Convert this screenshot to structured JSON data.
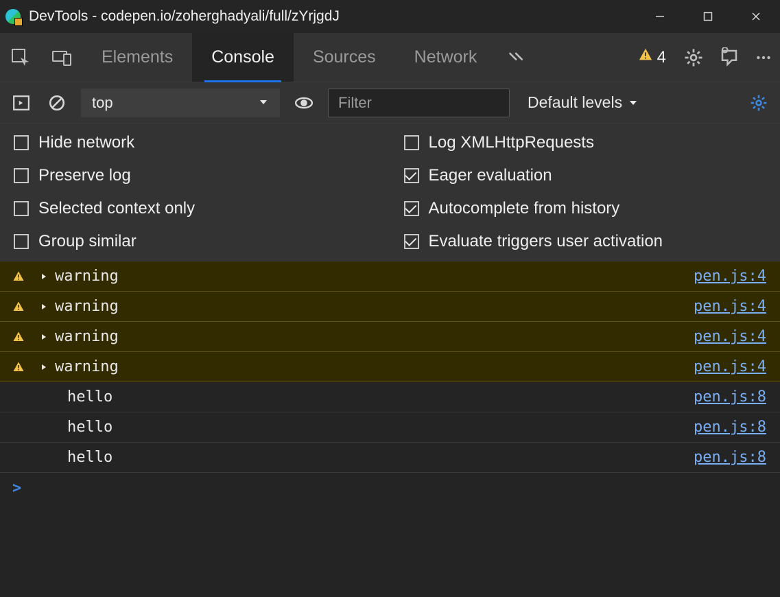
{
  "window": {
    "title": "DevTools - codepen.io/zoherghadyali/full/zYrjgdJ"
  },
  "tabs": {
    "items": [
      "Elements",
      "Console",
      "Sources",
      "Network"
    ],
    "activeIndex": 1,
    "warningCount": "4"
  },
  "toolbar": {
    "context": "top",
    "filterPlaceholder": "Filter",
    "levels": "Default levels"
  },
  "settings": {
    "left": [
      {
        "label": "Hide network",
        "checked": false
      },
      {
        "label": "Preserve log",
        "checked": false
      },
      {
        "label": "Selected context only",
        "checked": false
      },
      {
        "label": "Group similar",
        "checked": false
      }
    ],
    "right": [
      {
        "label": "Log XMLHttpRequests",
        "checked": false
      },
      {
        "label": "Eager evaluation",
        "checked": true
      },
      {
        "label": "Autocomplete from history",
        "checked": true
      },
      {
        "label": "Evaluate triggers user activation",
        "checked": true
      }
    ]
  },
  "logs": [
    {
      "type": "warn",
      "msg": "warning",
      "src": "pen.js:4"
    },
    {
      "type": "warn",
      "msg": "warning",
      "src": "pen.js:4"
    },
    {
      "type": "warn",
      "msg": "warning",
      "src": "pen.js:4"
    },
    {
      "type": "warn",
      "msg": "warning",
      "src": "pen.js:4"
    },
    {
      "type": "log",
      "msg": "hello",
      "src": "pen.js:8"
    },
    {
      "type": "log",
      "msg": "hello",
      "src": "pen.js:8"
    },
    {
      "type": "log",
      "msg": "hello",
      "src": "pen.js:8"
    }
  ],
  "prompt": ">"
}
